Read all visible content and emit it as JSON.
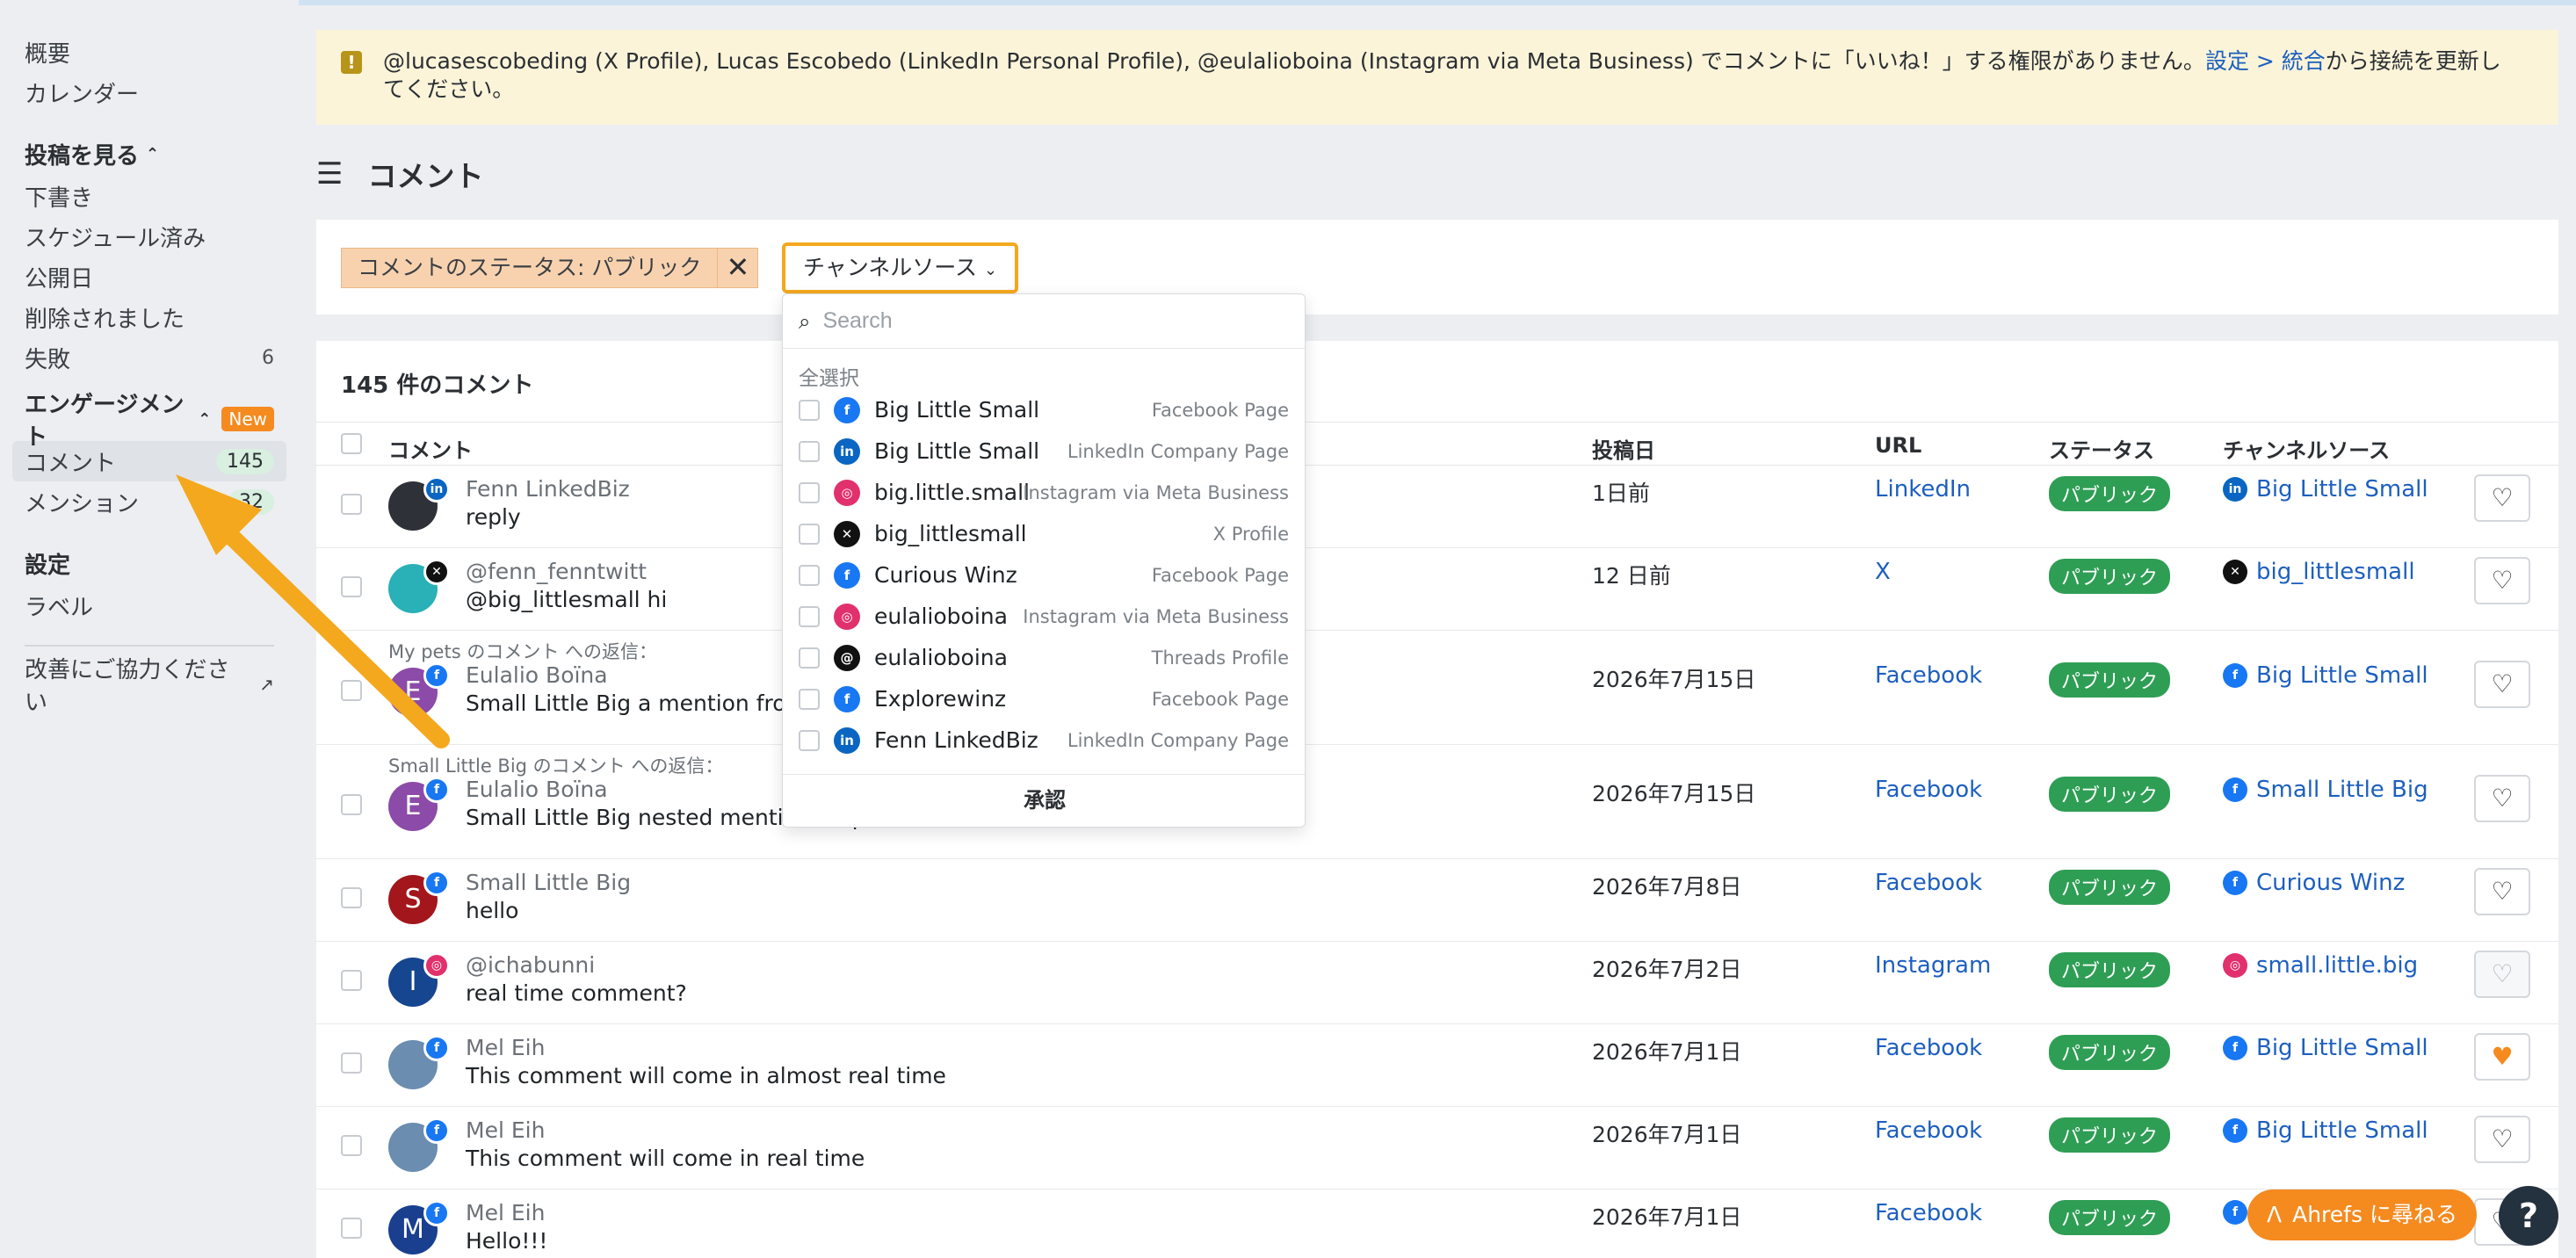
{
  "sidebar": {
    "overview": "概要",
    "calendar": "カレンダー",
    "posts_header": "投稿を見る",
    "drafts": "下書き",
    "scheduled": "スケジュール済み",
    "published": "公開日",
    "deleted": "削除されました",
    "failed": "失敗",
    "failed_count": "6",
    "engagement_header": "エンゲージメント",
    "new_badge": "New",
    "comments": "コメント",
    "comments_count": "145",
    "mentions": "メンション",
    "mentions_count": "32",
    "settings_header": "設定",
    "labels": "ラベル",
    "feedback": "改善にご協力ください"
  },
  "alert": {
    "text": "@lucasescobeding (X Profile), Lucas Escobedo (LinkedIn Personal Profile), @eulalioboina (Instagram via Meta Business) でコメントに「いいね！」する権限がありません。",
    "link": "設定 > 統合",
    "tail": "から接続を更新してください。"
  },
  "page": {
    "title": "コメント"
  },
  "filters": {
    "status_chip": "コメントのステータス: パブリック",
    "source_button": "チャンネルソース"
  },
  "dropdown": {
    "search_placeholder": "Search",
    "select_all": "全選択",
    "approve": "承認",
    "items": [
      {
        "name": "Big Little Small",
        "type": "Facebook Page",
        "icon": "facebook-icon"
      },
      {
        "name": "Big Little Small",
        "type": "LinkedIn Company Page",
        "icon": "linkedin-icon"
      },
      {
        "name": "big.little.small",
        "type": "Instagram via Meta Business",
        "icon": "instagram-icon"
      },
      {
        "name": "big_littlesmall",
        "type": "X Profile",
        "icon": "x-icon"
      },
      {
        "name": "Curious Winz",
        "type": "Facebook Page",
        "icon": "facebook-icon"
      },
      {
        "name": "eulalioboina",
        "type": "Instagram via Meta Business",
        "icon": "instagram-icon"
      },
      {
        "name": "eulalioboina",
        "type": "Threads Profile",
        "icon": "threads-icon"
      },
      {
        "name": "Explorewinz",
        "type": "Facebook Page",
        "icon": "facebook-icon"
      },
      {
        "name": "Fenn LinkedBiz",
        "type": "LinkedIn Company Page",
        "icon": "linkedin-icon"
      }
    ]
  },
  "table": {
    "count_title": "145 件のコメント",
    "headers": {
      "comment": "コメント",
      "date": "投稿日",
      "url": "URL",
      "status": "ステータス",
      "channel": "チャンネルソース"
    },
    "rows": [
      {
        "reply_note": "",
        "author": "Fenn LinkedBiz",
        "text": "reply",
        "date": "1日前",
        "url": "LinkedIn",
        "status": "パブリック",
        "channel": "Big Little Small",
        "channel_icon": "linkedin-icon",
        "avatar_letter": "",
        "liked": false
      },
      {
        "reply_note": "",
        "author": "@fenn_fenntwitt",
        "text": "@big_littlesmall hi",
        "date": "12 日前",
        "url": "X",
        "status": "パブリック",
        "channel": "big_littlesmall",
        "channel_icon": "x-icon",
        "avatar_letter": "",
        "liked": false
      },
      {
        "reply_note": "My pets のコメント への返信：",
        "author": "Eulalio Boïna",
        "text": "Small Little Big a mention from",
        "date": "2026年7月15日",
        "url": "Facebook",
        "status": "パブリック",
        "channel": "Big Little Small",
        "channel_icon": "facebook-icon",
        "avatar_letter": "E",
        "liked": false
      },
      {
        "reply_note": "Small Little Big のコメント への返信：",
        "author": "Eulalio Boïna",
        "text": "Small Little Big nested mention on post comment",
        "date": "2026年7月15日",
        "url": "Facebook",
        "status": "パブリック",
        "channel": "Small Little Big",
        "channel_icon": "facebook-icon",
        "avatar_letter": "E",
        "liked": false
      },
      {
        "reply_note": "",
        "author": "Small Little Big",
        "text": "hello",
        "date": "2026年7月8日",
        "url": "Facebook",
        "status": "パブリック",
        "channel": "Curious Winz",
        "channel_icon": "facebook-icon",
        "avatar_letter": "S",
        "liked": false
      },
      {
        "reply_note": "",
        "author": "@ichabunni",
        "text": "real time comment?",
        "date": "2026年7月2日",
        "url": "Instagram",
        "status": "パブリック",
        "channel": "small.little.big",
        "channel_icon": "instagram-icon",
        "avatar_letter": "I",
        "liked": false
      },
      {
        "reply_note": "",
        "author": "Mel Eih",
        "text": "This comment will come in almost real time",
        "date": "2026年7月1日",
        "url": "Facebook",
        "status": "パブリック",
        "channel": "Big Little Small",
        "channel_icon": "facebook-icon",
        "avatar_letter": "",
        "liked": true
      },
      {
        "reply_note": "",
        "author": "Mel Eih",
        "text": "This comment will come in real time",
        "date": "2026年7月1日",
        "url": "Facebook",
        "status": "パブリック",
        "channel": "Big Little Small",
        "channel_icon": "facebook-icon",
        "avatar_letter": "",
        "liked": false
      },
      {
        "reply_note": "",
        "author": "Mel Eih",
        "text": "Hello!!!",
        "date": "2026年7月1日",
        "url": "Facebook",
        "status": "パブリック",
        "channel": "",
        "channel_icon": "facebook-icon",
        "avatar_letter": "M",
        "liked": false
      }
    ]
  },
  "help": {
    "ask_label": "Ahrefs に尋ねる",
    "question_mark": "?"
  },
  "colors": {
    "accent": "#f58a1f",
    "link": "#1d5fbf",
    "status_green": "#2f9e55",
    "alert_bg": "#fbf4d9",
    "facebook": "#1877f2",
    "linkedin": "#0a66c2",
    "instagram": "#e1306c",
    "x": "#111111"
  }
}
